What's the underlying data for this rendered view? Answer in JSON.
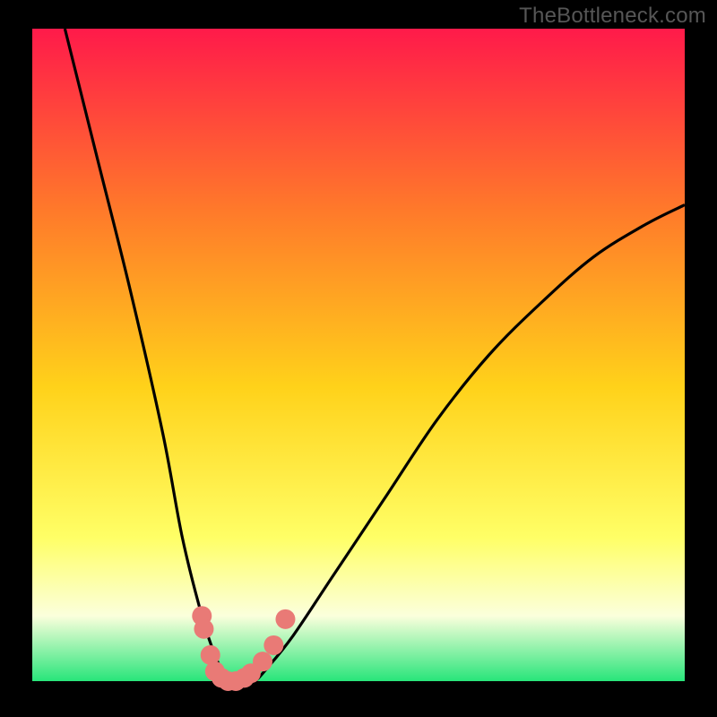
{
  "watermark": "TheBottleneck.com",
  "colors": {
    "frame": "#000000",
    "gradient_top": "#ff1a4a",
    "gradient_mid1": "#ff7a2a",
    "gradient_mid2": "#ffd21a",
    "gradient_mid3": "#ffff66",
    "gradient_mid4": "#fbffdc",
    "gradient_bottom": "#28e57a",
    "curve": "#000000",
    "marker": "#e97a76"
  },
  "chart_data": {
    "type": "line",
    "title": "",
    "xlabel": "",
    "ylabel": "",
    "xlim": [
      0,
      100
    ],
    "ylim": [
      0,
      100
    ],
    "series": [
      {
        "name": "bottleneck-curve",
        "x": [
          5,
          10,
          15,
          20,
          23,
          26,
          28,
          30,
          32,
          34,
          36,
          40,
          46,
          54,
          62,
          70,
          78,
          86,
          94,
          100
        ],
        "y": [
          100,
          80,
          60,
          38,
          22,
          10,
          4,
          0,
          0,
          0,
          2,
          7,
          16,
          28,
          40,
          50,
          58,
          65,
          70,
          73
        ]
      }
    ],
    "markers": [
      {
        "x": 26.0,
        "y": 10
      },
      {
        "x": 26.3,
        "y": 8
      },
      {
        "x": 27.3,
        "y": 4
      },
      {
        "x": 28.0,
        "y": 1.5
      },
      {
        "x": 29.0,
        "y": 0.5
      },
      {
        "x": 30.0,
        "y": 0
      },
      {
        "x": 31.2,
        "y": 0
      },
      {
        "x": 32.5,
        "y": 0.5
      },
      {
        "x": 33.5,
        "y": 1.2
      },
      {
        "x": 35.3,
        "y": 3.0
      },
      {
        "x": 37.0,
        "y": 5.5
      },
      {
        "x": 38.8,
        "y": 9.5
      }
    ],
    "grid": false,
    "legend": false
  }
}
